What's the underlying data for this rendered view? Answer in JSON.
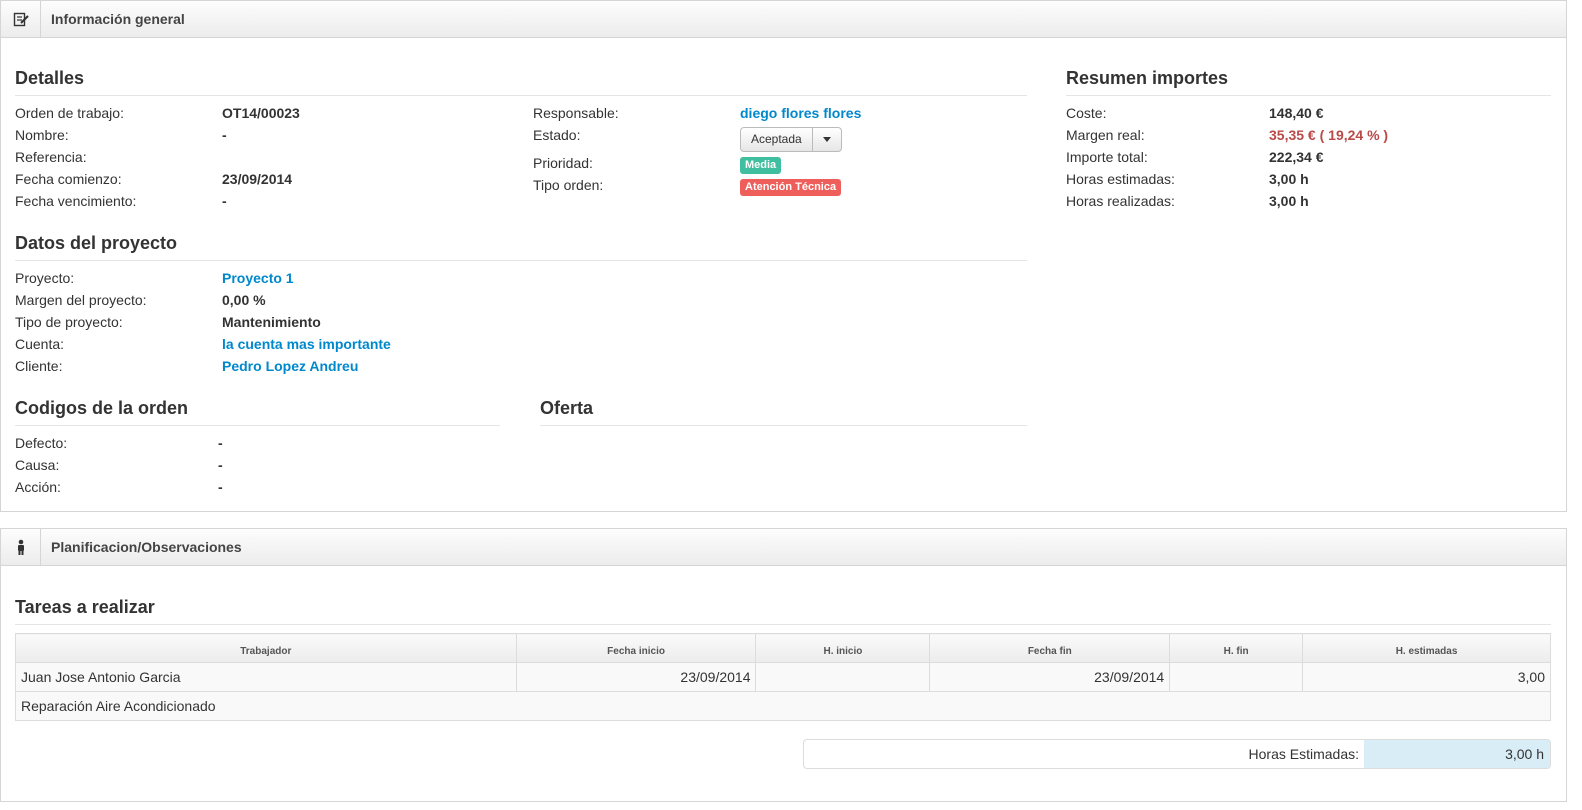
{
  "general": {
    "title": "Información general",
    "detalles": {
      "title": "Detalles",
      "orden_label": "Orden de trabajo:",
      "orden_value": "OT14/00023",
      "nombre_label": "Nombre:",
      "nombre_value": "-",
      "referencia_label": "Referencia:",
      "fecha_comienzo_label": "Fecha comienzo:",
      "fecha_comienzo_value": "23/09/2014",
      "fecha_venc_label": "Fecha vencimiento:",
      "fecha_venc_value": "-",
      "responsable_label": "Responsable:",
      "responsable_value": "diego flores flores",
      "estado_label": "Estado:",
      "estado_value": "Aceptada",
      "prioridad_label": "Prioridad:",
      "prioridad_value": "Media",
      "tipo_orden_label": "Tipo orden:",
      "tipo_orden_value": "Atención Técnica"
    },
    "resumen": {
      "title": "Resumen importes",
      "coste_label": "Coste:",
      "coste_value": "148,40 €",
      "margen_label": "Margen real:",
      "margen_value": "35,35 € ( 19,24 % )",
      "importe_label": "Importe total:",
      "importe_value": "222,34 €",
      "horas_est_label": "Horas estimadas:",
      "horas_est_value": "3,00 h",
      "horas_real_label": "Horas realizadas:",
      "horas_real_value": "3,00 h"
    },
    "proyecto": {
      "title": "Datos del proyecto",
      "proyecto_label": "Proyecto:",
      "proyecto_value": "Proyecto 1",
      "margen_label": "Margen del proyecto:",
      "margen_value": "0,00 %",
      "tipo_label": "Tipo de proyecto:",
      "tipo_value": "Mantenimiento",
      "cuenta_label": "Cuenta:",
      "cuenta_value": "la cuenta mas importante",
      "cliente_label": "Cliente:",
      "cliente_value": "Pedro Lopez Andreu"
    },
    "codigos": {
      "title": "Codigos de la orden",
      "defecto_label": "Defecto:",
      "defecto_value": "-",
      "causa_label": "Causa:",
      "causa_value": "-",
      "accion_label": "Acción:",
      "accion_value": "-"
    },
    "oferta": {
      "title": "Oferta"
    }
  },
  "planificacion": {
    "title": "Planificacion/Observaciones",
    "tareas_title": "Tareas a realizar",
    "columns": [
      "Trabajador",
      "Fecha inicio",
      "H. inicio",
      "Fecha fin",
      "H. fin",
      "H. estimadas"
    ],
    "row": {
      "trabajador": "Juan Jose Antonio Garcia",
      "fecha_inicio": "23/09/2014",
      "h_inicio": "",
      "fecha_fin": "23/09/2014",
      "h_fin": "",
      "h_estimadas": "3,00",
      "descripcion": "Reparación Aire Acondicionado"
    },
    "totals_label": "Horas Estimadas:",
    "totals_value": "3,00 h"
  },
  "colors": {
    "link": "#0088cc",
    "danger": "#b94a48",
    "badge_media": "#3fbf9f",
    "badge_tipo": "#ee5f5b"
  }
}
